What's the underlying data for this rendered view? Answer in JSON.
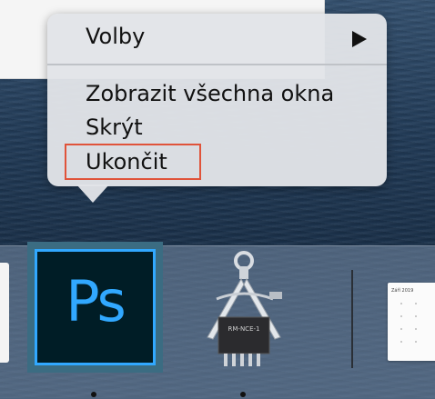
{
  "context_menu": {
    "items": [
      {
        "label": "Volby",
        "has_submenu": true
      },
      {
        "label": "Zobrazit všechna okna"
      },
      {
        "label": "Skrýt"
      },
      {
        "label": "Ukončit",
        "highlighted": true
      }
    ]
  },
  "dock": {
    "apps": [
      {
        "name": "photoshop",
        "icon_text": "Ps",
        "running": true
      },
      {
        "name": "system-information",
        "icon_text": "RM-NCE-1",
        "running": true
      },
      {
        "name": "calendar-window",
        "title": "Září 2019"
      }
    ]
  },
  "colors": {
    "highlight_border": "#e0533a",
    "ps_blue": "#31a8ff",
    "ps_background": "#001d26"
  }
}
